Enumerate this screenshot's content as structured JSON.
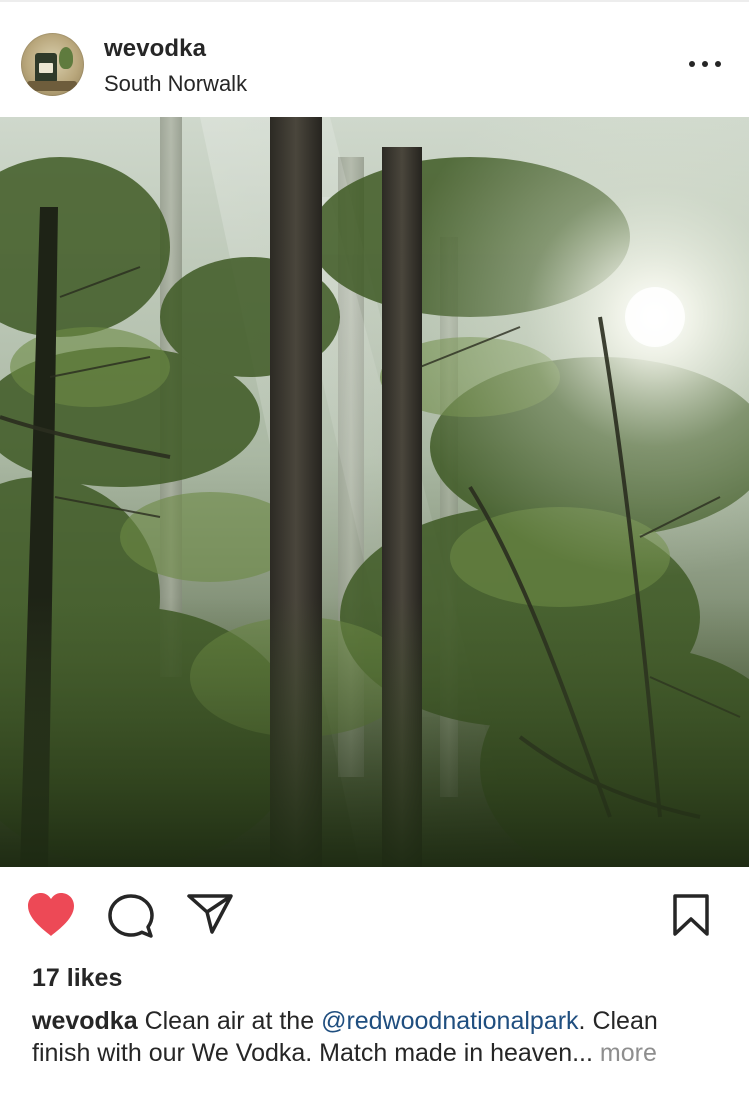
{
  "post": {
    "username": "wevodka",
    "location": "South Norwalk",
    "likes_text": "17 likes",
    "caption": {
      "username": "wevodka",
      "text_before": "Clean air at the",
      "mention": "@redwoodnationalpark",
      "text_after": ". Clean finish with our We Vodka. Match made in heaven...",
      "more_label": "more"
    }
  },
  "icons": {
    "more": "more-options-icon",
    "like": "heart-icon",
    "comment": "comment-icon",
    "share": "direct-share-icon",
    "save": "bookmark-icon"
  },
  "colors": {
    "like_active": "#ed4956",
    "mention": "#1f4e7f",
    "muted": "#8e8e8e",
    "text": "#262626"
  }
}
